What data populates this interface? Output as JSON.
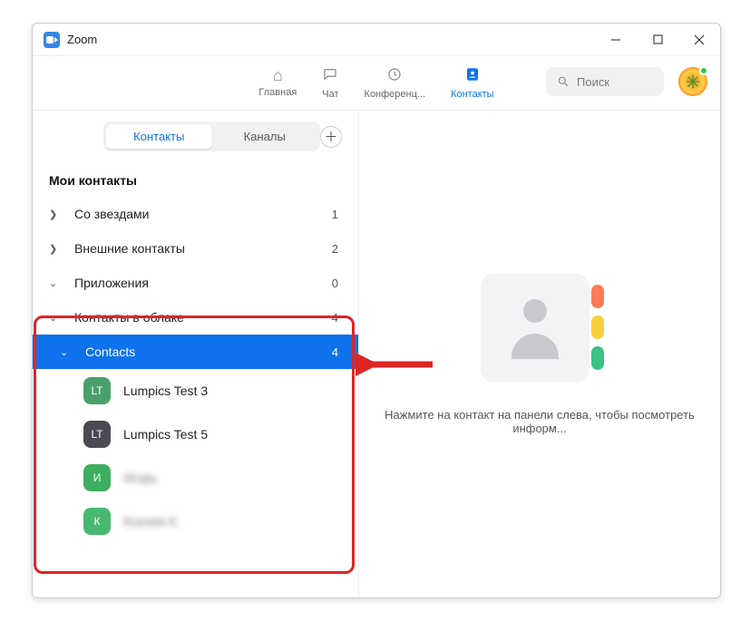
{
  "window": {
    "title": "Zoom"
  },
  "nav": {
    "home": "Главная",
    "chat": "Чат",
    "meetings": "Конференц...",
    "contacts": "Контакты"
  },
  "search": {
    "placeholder": "Поиск"
  },
  "segments": {
    "contacts": "Контакты",
    "channels": "Каналы"
  },
  "section_header": "Мои контакты",
  "groups": {
    "starred": {
      "label": "Со звездами",
      "count": "1"
    },
    "external": {
      "label": "Внешние контакты",
      "count": "2"
    },
    "apps": {
      "label": "Приложения",
      "count": "0"
    },
    "cloud": {
      "label": "Контакты в облаке",
      "count": "4"
    },
    "contacts_sub": {
      "label": "Contacts",
      "count": "4"
    }
  },
  "contacts": [
    {
      "initials": "LT",
      "name": "Lumpics Test 3",
      "color": "#4aa06a"
    },
    {
      "initials": "LT",
      "name": "Lumpics Test 5",
      "color": "#4a4a52"
    },
    {
      "initials": "И",
      "name": "Игорь",
      "color": "#3cae5e",
      "blur": true
    },
    {
      "initials": "К",
      "name": "Ксения К.",
      "color": "#47b870",
      "blur": true
    }
  ],
  "placeholder_text": "Нажмите на контакт на панели слева, чтобы посмотреть информ..."
}
